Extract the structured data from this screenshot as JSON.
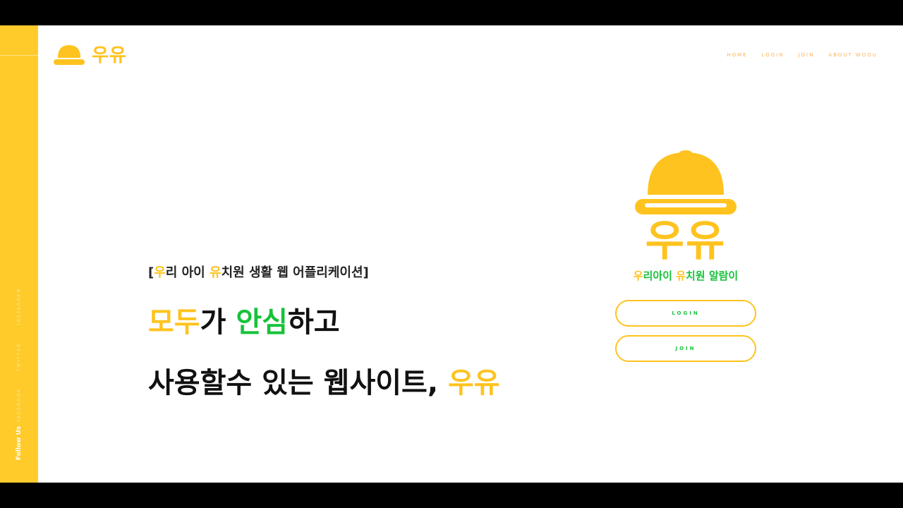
{
  "colors": {
    "brand_yellow": "#ffc31f",
    "sidebar_yellow": "#ffcb2b",
    "accent_green": "#16c23a",
    "nav_orange": "#ffb35c"
  },
  "sidebar": {
    "social_links": [
      "INSTAGRAM",
      "TWITTER",
      "FACEBOOK"
    ],
    "follow_label": "Follow Us"
  },
  "brand": {
    "logo_text": "우유",
    "logo_icon": "hat-icon"
  },
  "nav": {
    "items": [
      "HOME",
      "LOGIN",
      "JOIN",
      "ABOUT WOOU"
    ]
  },
  "hero": {
    "subtitle_open": "[",
    "subtitle_u1": "우",
    "subtitle_mid1": "리 아이 ",
    "subtitle_u2": "유",
    "subtitle_rest": "치원 생활 웹 어플리케이션]",
    "line1_part1": "모두",
    "line1_part2": "가 ",
    "line1_part3": "안심",
    "line1_part4": "하고",
    "line2_part1": "사용할수 있는 웹사이트, ",
    "line2_part2": "우유"
  },
  "card": {
    "big_logo_text": "우유",
    "tag_u1": "우",
    "tag_mid": "리아이 ",
    "tag_u2": "유",
    "tag_rest": "치원 알람이",
    "login_button": "LOGIN",
    "join_button": "JOIN"
  }
}
